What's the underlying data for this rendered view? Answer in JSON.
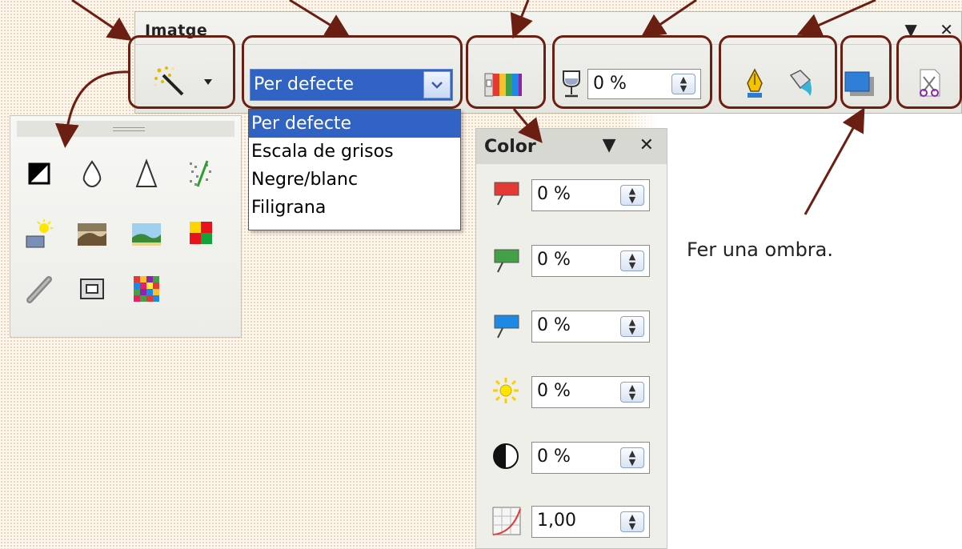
{
  "toolbar": {
    "title": "Imatge",
    "menu_glyph": "▼",
    "close_glyph": "✕",
    "transparency_value": "0 %"
  },
  "graphics_mode": {
    "selected": "Per defecte",
    "options": [
      "Per defecte",
      "Escala de grisos",
      "Negre/blanc",
      "Filigrana"
    ]
  },
  "color_panel": {
    "title": "Color",
    "menu_glyph": "▼",
    "close_glyph": "✕",
    "red_value": "0 %",
    "green_value": "0 %",
    "blue_value": "0 %",
    "brightness_value": "0 %",
    "contrast_value": "0 %",
    "gamma_value": "1,00"
  },
  "annotation": {
    "shadow_text": "Fer una ombra."
  },
  "colors": {
    "annotation_stroke": "#6b1e12",
    "selection_blue": "#3163c4"
  }
}
